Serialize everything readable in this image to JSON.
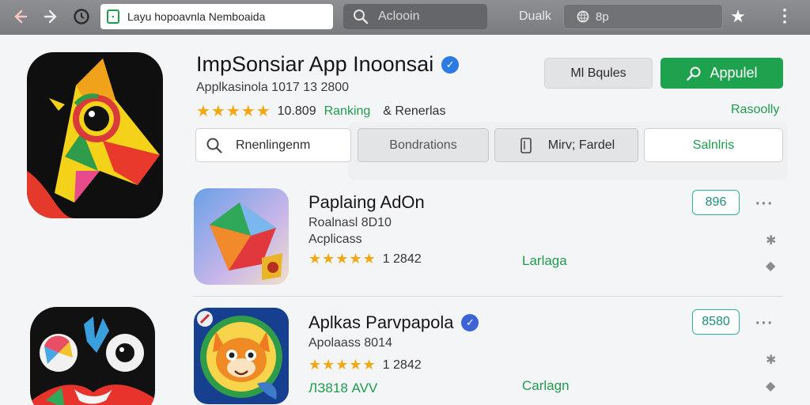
{
  "browser": {
    "url": "Layu hopoavnla Nemboaida",
    "site_badge": "▪",
    "search_label": "Aclooin",
    "side_label": "Dualk",
    "side_field": "8p"
  },
  "hero": {
    "title": "ImpSonsiar App Inoonsai",
    "subtitle": "Applkasinola 1017 13 2800",
    "stars": "★★★★★",
    "rating_count": "10.809",
    "ranking": "Ranking",
    "reviews": "& Renerlas",
    "button_secondary": "Ml Bqules",
    "button_primary": "Appulel",
    "popular": "Rasoolly"
  },
  "filters": {
    "search_value": "Rnenlingenm",
    "chip1": "Bondrations",
    "chip2": "Mirv; Fardel",
    "chip3": "Salnlris"
  },
  "apps": [
    {
      "title": "Paplaing AdOn",
      "line1": "Roalnasl 8D10",
      "line2": "Acplicass",
      "stars": "★★★★★",
      "count": "1 2842",
      "category": "Larlaga",
      "price": "896"
    },
    {
      "title": "Aplkas Parvpapola",
      "line1": "Apolaass 8014",
      "line2": "",
      "stars": "★★★★★",
      "count": "1 2842",
      "category": "Carlagn",
      "extra": "ЛЗ818 AVV",
      "price": "8580"
    }
  ],
  "colors": {
    "accent_green": "#1fa24d",
    "star_gold": "#f2a713",
    "price_teal": "#2fb39a"
  }
}
